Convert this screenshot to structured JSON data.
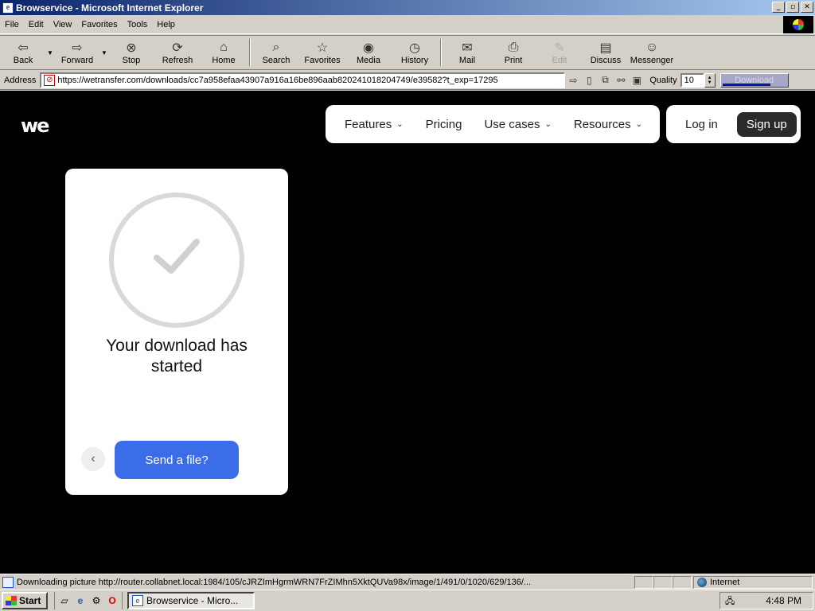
{
  "window": {
    "title": "Browservice - Microsoft Internet Explorer"
  },
  "menu": [
    "File",
    "Edit",
    "View",
    "Favorites",
    "Tools",
    "Help"
  ],
  "toolbar": {
    "back": "Back",
    "forward": "Forward",
    "stop": "Stop",
    "refresh": "Refresh",
    "home": "Home",
    "search": "Search",
    "favorites": "Favorites",
    "media": "Media",
    "history": "History",
    "mail": "Mail",
    "print": "Print",
    "edit": "Edit",
    "discuss": "Discuss",
    "messenger": "Messenger"
  },
  "address": {
    "label": "Address",
    "url": "https://wetransfer.com/downloads/cc7a958efaa43907a916a16be896aab820241018204749/e39582?t_exp=17295",
    "quality_label": "Quality",
    "quality_value": "10",
    "download_label": "Download"
  },
  "page": {
    "logo": "we",
    "nav": [
      {
        "label": "Features",
        "has_dropdown": true
      },
      {
        "label": "Pricing",
        "has_dropdown": false
      },
      {
        "label": "Use cases",
        "has_dropdown": true
      },
      {
        "label": "Resources",
        "has_dropdown": true
      }
    ],
    "login": "Log in",
    "signup": "Sign up",
    "card": {
      "title": "Your download has started",
      "send_button": "Send a file?"
    }
  },
  "status": {
    "text": "Downloading picture http://router.collabnet.local:1984/105/cJRZImHgrmWRN7FrZIMhn5XktQUVa98x/image/1/491/0/1020/629/136/...",
    "zone": "Internet"
  },
  "taskbar": {
    "start": "Start",
    "task": "Browservice - Micro...",
    "clock": "4:48 PM"
  },
  "colors": {
    "accent": "#3c6de8",
    "titlebar": "#0a246a"
  }
}
